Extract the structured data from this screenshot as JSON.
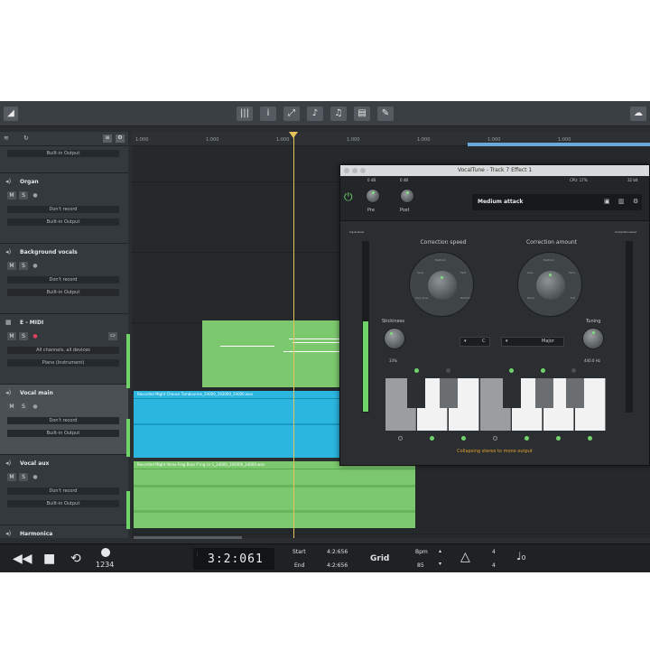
{
  "timeline": {
    "ticks": [
      "1:000",
      "1:000",
      "1:000",
      "1:000",
      "1:000",
      "1:000",
      "1:000",
      "1:000"
    ]
  },
  "tracks": [
    {
      "name": "",
      "outputs": [
        "Built-in Output"
      ]
    },
    {
      "name": "Organ",
      "buttons": [
        "M",
        "S"
      ],
      "fields": [
        "Don't record",
        "Built-in Output"
      ]
    },
    {
      "name": "Background vocals",
      "buttons": [
        "M",
        "S"
      ],
      "fields": [
        "Don't record",
        "Built-in Output"
      ]
    },
    {
      "name": "E - MIDI",
      "buttons": [
        "M",
        "S"
      ],
      "fields": [
        "All channels, all devices",
        "Piano (Instrument)"
      ]
    },
    {
      "name": "Vocal main",
      "buttons": [
        "M",
        "S"
      ],
      "fields": [
        "Don't record",
        "Built-in Output"
      ]
    },
    {
      "name": "Vocal aux",
      "buttons": [
        "M",
        "S"
      ],
      "fields": [
        "Don't record",
        "Built-in Output"
      ]
    },
    {
      "name": "Harmonica"
    }
  ],
  "clips": {
    "vocal_main": "Recorded Might Choose Tambourine_24000_192000_24000.wav",
    "vocal_aux": "Recorded Might Verse Frog Bass P ing sir 1_24000_192000_24000.wav"
  },
  "plugin": {
    "title": "VocalTune - Track 7 Effect 1",
    "time_left": "0 dB",
    "time_right": "0 dB",
    "cpu": "CPU: 17%",
    "bits": "32 bit",
    "pre_label": "Pre",
    "post_label": "Post",
    "preset": "Medium attack",
    "input_level": "Input level",
    "correction_level": "Correction level",
    "correction_speed": "Correction speed",
    "correction_amount": "Correction amount",
    "speed_dial_labels": [
      "Medium",
      "Slow",
      "Fast",
      "Robotic",
      "Very slow"
    ],
    "amount_dial_labels": [
      "Medium",
      "Less",
      "More",
      "None",
      "Full"
    ],
    "stickiness": "Stickiness",
    "stickiness_value": "33%",
    "key_value": "C",
    "scale_value": "Major",
    "tuning": "Tuning",
    "tuning_value": "440.0 Hz",
    "footer": "Collapsing stereo to mono output",
    "colors": {
      "accent": "#6fd36a",
      "warning": "#e0a030"
    }
  },
  "transport": {
    "time": "3:2:061",
    "start_label": "Start",
    "start_value": "4:2:656",
    "end_label": "End",
    "end_value": "4:2:656",
    "grid_label": "Grid",
    "bpm_label": "Bpm",
    "bpm_value": "85",
    "count_in": "1234",
    "sig_top": "4",
    "sig_bottom": "4"
  }
}
